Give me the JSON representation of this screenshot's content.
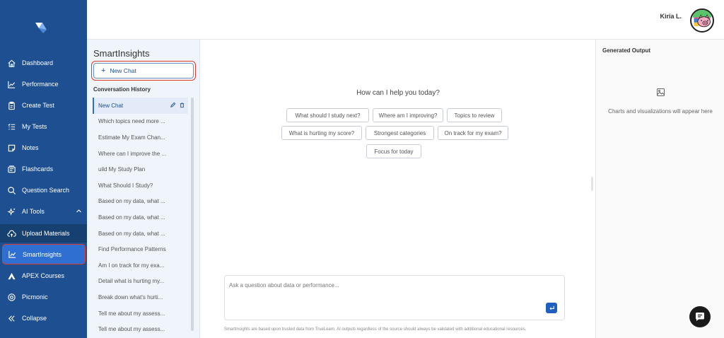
{
  "sidebar": {
    "items": [
      {
        "label": "Dashboard",
        "icon": "home-icon"
      },
      {
        "label": "Performance",
        "icon": "line-chart-icon"
      },
      {
        "label": "Create Test",
        "icon": "clipboard-icon"
      },
      {
        "label": "My Tests",
        "icon": "list-icon"
      },
      {
        "label": "Notes",
        "icon": "note-icon"
      },
      {
        "label": "Flashcards",
        "icon": "flashcards-icon"
      },
      {
        "label": "Question Search",
        "icon": "search-icon"
      },
      {
        "label": "AI Tools",
        "icon": "sparkle-icon"
      },
      {
        "label": "Upload Materials",
        "icon": "cloud-upload-icon"
      },
      {
        "label": "SmartInsights",
        "icon": "chart-icon"
      },
      {
        "label": "APEX Courses",
        "icon": "apex-icon"
      },
      {
        "label": "Picmonic",
        "icon": "eye-icon"
      },
      {
        "label": "Collapse",
        "icon": "double-chevron-left-icon"
      }
    ]
  },
  "header": {
    "user_name": "Kiria L."
  },
  "conversations": {
    "title": "SmartInsights",
    "new_chat_label": "New Chat",
    "history_title": "Conversation History",
    "items": [
      "New Chat",
      "Which topics need more ...",
      "Estimate My Exam Chan...",
      "Where can I improve the ...",
      "uild My Study Plan",
      "What Should I Study?",
      "Based on my data, what ...",
      "Based on my data, what ...",
      "Based on my data, what ...",
      "Find Performance Patterns",
      "Am I on track for my exa...",
      "Detail what is hurting my...",
      "Break down what's hurti...",
      "Tell me about my assess...",
      "Tell me about my assess..."
    ]
  },
  "main": {
    "prompt_title": "How can I help you today?",
    "suggestions": [
      "What should I study next?",
      "Where am I improving?",
      "Topics to review",
      "What is hurting my score?",
      "Strongest categories",
      "On track for my exam?",
      "Focus for today"
    ],
    "input_placeholder": "Ask a question about data or performance...",
    "disclaimer": "SmartInsights are based upon trusted data from TrueLearn. AI outputs regardless of the source should always be validated with additional educational resources."
  },
  "output": {
    "title": "Generated Output",
    "placeholder": "Charts and visualizations will appear here"
  },
  "colors": {
    "sidebar_bg": "#1d4f91",
    "active_bg": "#2f6fd1",
    "highlight_border": "#e03a2f",
    "accent": "#1f5fbf"
  }
}
